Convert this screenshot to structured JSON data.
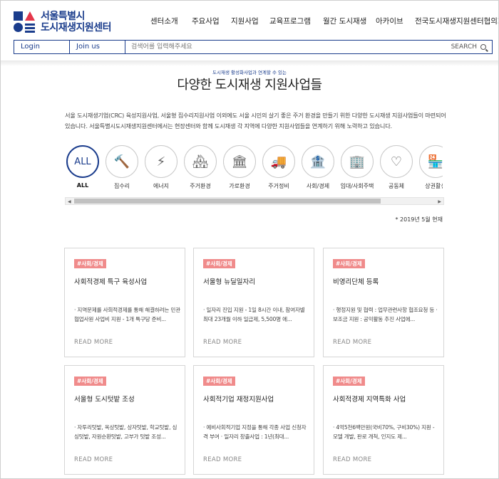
{
  "header": {
    "logo_line1": "서울특별시",
    "logo_line2": "도시재생지원센터",
    "nav": [
      "센터소개",
      "주요사업",
      "지원사업",
      "교육프로그램",
      "월간 도시재생",
      "아카이브",
      "전국도시재생지원센터협의회"
    ],
    "login_label": "Login",
    "join_label": "Join us",
    "search_placeholder": "검색어를 입력해주세요",
    "search_label": "SEARCH"
  },
  "section": {
    "kicker": "도시재생 활성화사업과 연계할 수 있는",
    "title": "다양한 도시재생 지원사업들",
    "description": "서울 도시재생기업(CRC) 육성지원사업, 서울형 집수리지원사업 이외에도 서울 시민의 살기 좋은 주거 환경을 만들기 위한 다양한 도시재생 지원사업들이 마련되어 있습니다. 서울특별시도시재생지원센터에서는 현장센터와 함께 도시재생 각 지역에 다양한 지원사업들을 연계하기 위해 노력하고 있습니다.",
    "as_of": "* 2019년 5월 현재"
  },
  "categories": [
    {
      "label": "ALL",
      "icon": "all-text",
      "glyph": "ALL",
      "active": true
    },
    {
      "label": "집수리",
      "icon": "hammer-icon",
      "glyph": "🔨"
    },
    {
      "label": "에너지",
      "icon": "energy-icon",
      "glyph": "⚡"
    },
    {
      "label": "주거환경",
      "icon": "house-icon",
      "glyph": "🏘"
    },
    {
      "label": "가로환경",
      "icon": "street-icon",
      "glyph": "🏛"
    },
    {
      "label": "주거정비",
      "icon": "truck-icon",
      "glyph": "🚚"
    },
    {
      "label": "사회/경제",
      "icon": "bank-icon",
      "glyph": "🏦"
    },
    {
      "label": "임대/사회주택",
      "icon": "building-icon",
      "glyph": "🏢"
    },
    {
      "label": "공동체",
      "icon": "heart-hand-icon",
      "glyph": "♡"
    },
    {
      "label": "상권활성",
      "icon": "shop-icon",
      "glyph": "🏪"
    }
  ],
  "cards": [
    {
      "tag": "#사회/경제",
      "title": "사회적경제 특구 육성사업",
      "body": "· 지역문제를 사회적경제를 통해 해결하려는 민관협업사원 사업비 지원 - 1개 특구당 준비...",
      "more": "READ MORE"
    },
    {
      "tag": "#사회/경제",
      "title": "서울형 뉴딜일자리",
      "body": "· 일자리 진입 지원 - 1일 8시간 이내, 참여자별 최대 23개월 이하 일급제, 5,500명 에...",
      "more": "READ MORE"
    },
    {
      "tag": "#사회/경제",
      "title": "비영리단체 등록",
      "body": "· 행정지원 및 협력 : 업무관련사항 협조요청 등 · 보조금 지원 : 공익활동 추진 사업에...",
      "more": "READ MORE"
    },
    {
      "tag": "#사회/경제",
      "title": "서울형 도시텃밭 조성",
      "body": "· 자투리텃밭, 옥상텃밭, 상자텃밭, 학교텃밭, 싱싱텃밭, 자원순환텃밭, 고부가 텃밭 조성...",
      "more": "READ MORE"
    },
    {
      "tag": "#사회/경제",
      "title": "사회적기업 재정지원사업",
      "body": "· 예비사회적기업 지정을 통해 각종 사업 신청자격 부여 · 일자리 창출사업 : 1년(최대...",
      "more": "READ MORE"
    },
    {
      "tag": "#사회/경제",
      "title": "사회적경제 지역특화 사업",
      "body": "· 4억5천6백만원(국비70%, 구비30%) 지원 - 모델 개발, 판로 개척, 인지도 제...",
      "more": "READ MORE"
    }
  ],
  "colors": {
    "brand": "#1a3c8c",
    "tag": "#f08b8b",
    "accent_red": "#e5374b"
  }
}
